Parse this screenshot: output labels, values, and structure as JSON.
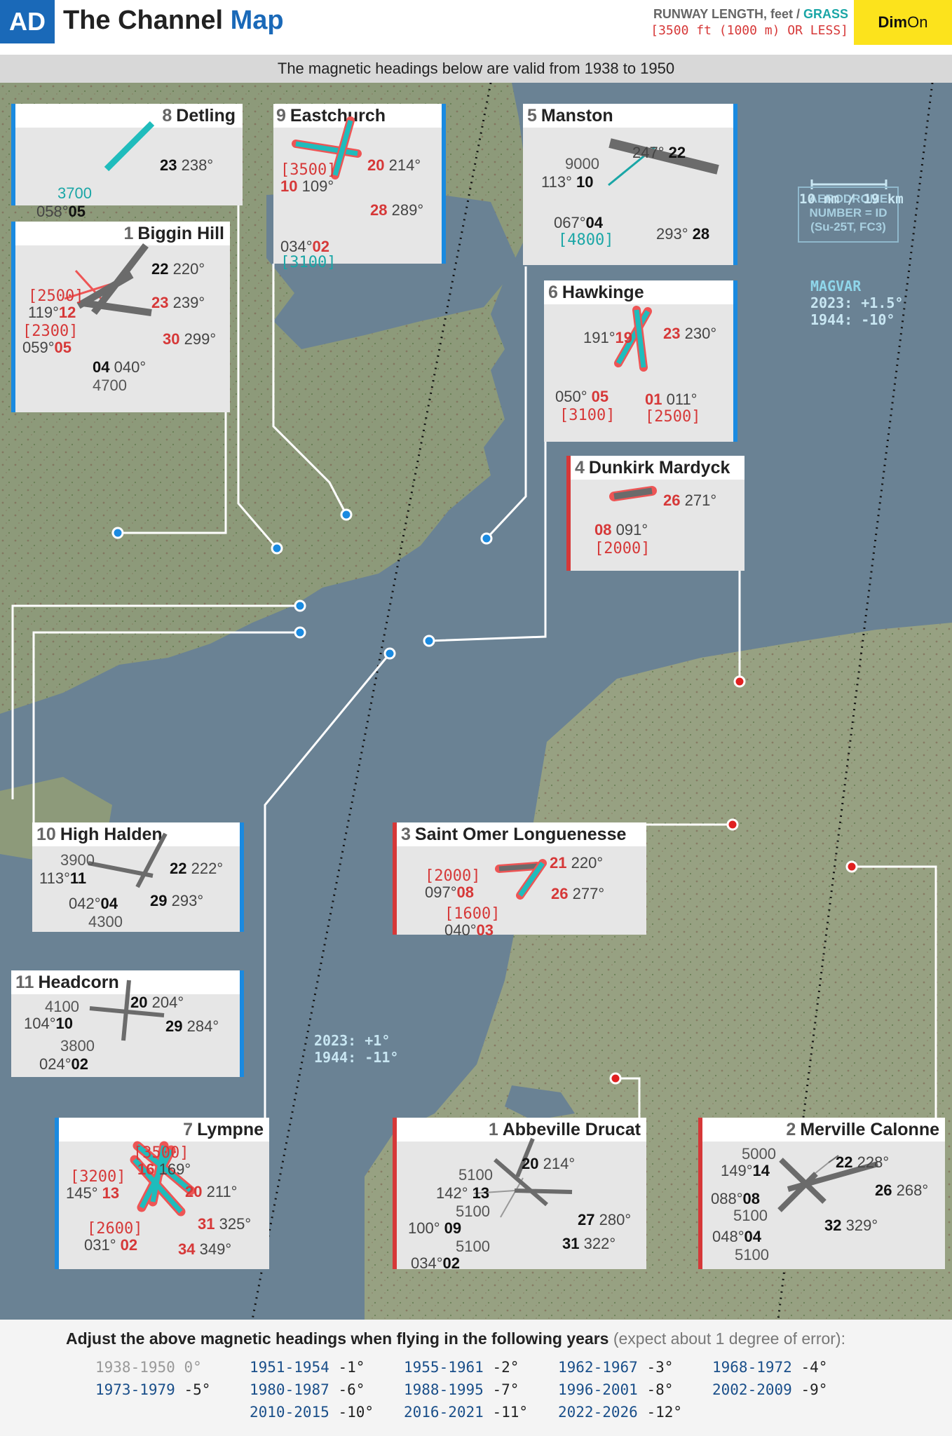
{
  "header": {
    "badge": "AD",
    "title_main": "The Channel",
    "title_accent": "Map",
    "legend_line1": "RUNWAY LENGTH, feet /",
    "legend_grass": "GRASS",
    "legend_line2": "[3500 ft (1000 m) OR LESS]",
    "brand_bold": "Dim",
    "brand_thin": "On"
  },
  "validity": "The magnetic headings below are valid from 1938 to 1950",
  "map": {
    "key_line1": "AERODROME",
    "key_line2": "NUMBER = ID",
    "key_line3": "(Su-25T, FC3)",
    "scale": "10 nm / 19 km",
    "magvar_title": "MAGVAR",
    "magvar_east_1": "2023: +1.5°",
    "magvar_east_2": "1944: -10°",
    "magvar_west_1": "2023: +1°",
    "magvar_west_2": "1944: -11°",
    "colors": {
      "sea": "#6a8294",
      "land": "#8a9a78",
      "blue_pin": "#1a8ae0",
      "red_pin": "#e02020",
      "grass": "#1aa6a6",
      "red_text": "#d63838"
    }
  },
  "airfields": {
    "detling": {
      "num": "8",
      "name": "Detling",
      "h1rw": "23",
      "h1": "238°",
      "len": "3700",
      "h2": "058°",
      "h2rw": "05"
    },
    "eastchurch": {
      "num": "9",
      "name": "Eastchurch",
      "l1": "[3500]",
      "l2rw": "10",
      "l2": "109°",
      "r1rw": "20",
      "r1": "214°",
      "r2rw": "28",
      "r2": "289°",
      "b1": "034°",
      "b1rw": "02",
      "b2": "[3100]"
    },
    "manston": {
      "num": "5",
      "name": "Manston",
      "len": "9000",
      "l1": "113°",
      "l1rw": "10",
      "t1": "247°",
      "t1rw": "22",
      "b1": "067°",
      "b1rw": "04",
      "b2": "[4800]",
      "r1": "293°",
      "r1rw": "28"
    },
    "biggin": {
      "num": "1",
      "name": "Biggin Hill",
      "r1rw": "22",
      "r1": "220°",
      "l1": "[2500]",
      "l2": "119°",
      "l2rw": "12",
      "r2rw": "23",
      "r2": "239°",
      "l3": "[2300]",
      "l4": "059°",
      "l4rw": "05",
      "r3rw": "30",
      "r3": "299°",
      "b1rw": "04",
      "b1": "040°",
      "b2": "4700"
    },
    "hawkinge": {
      "num": "6",
      "name": "Hawkinge",
      "l1": "191°",
      "l1rw": "19",
      "r1rw": "23",
      "r1": "230°",
      "l2": "050°",
      "l2rw": "05",
      "l3": "[3100]",
      "r2rw": "01",
      "r2": "011°",
      "r3": "[2500]"
    },
    "dunkirk": {
      "num": "4",
      "name": "Dunkirk Mardyck",
      "r1rw": "26",
      "r1": "271°",
      "l1rw": "08",
      "l1": "091°",
      "b1": "[2000]"
    },
    "highhalden": {
      "num": "10",
      "name": "High Halden",
      "len1": "3900",
      "l1": "113°",
      "l1rw": "11",
      "r1rw": "22",
      "r1": "222°",
      "r2rw": "29",
      "r2": "293°",
      "b1": "042°",
      "b1rw": "04",
      "b2": "4300"
    },
    "headcorn": {
      "num": "11",
      "name": "Headcorn",
      "len1": "4100",
      "l1": "104°",
      "l1rw": "10",
      "r1rw": "20",
      "r1": "204°",
      "r2rw": "29",
      "r2": "284°",
      "len2": "3800",
      "b1": "024°",
      "b1rw": "02"
    },
    "stomer": {
      "num": "3",
      "name": "Saint Omer Longuenesse",
      "r1rw": "21",
      "r1": "220°",
      "l1": "[2000]",
      "l2": "097°",
      "l2rw": "08",
      "r2rw": "26",
      "r2": "277°",
      "l3": "[1600]",
      "l4": "040°",
      "l4rw": "03"
    },
    "lympne": {
      "num": "7",
      "name": "Lympne",
      "t1": "[3500]",
      "t2rw": "16",
      "t2": "169°",
      "l1": "[3200]",
      "l2": "145°",
      "l2rw": "13",
      "r1rw": "20",
      "r1": "211°",
      "r2rw": "31",
      "r2": "325°",
      "l3": "[2600]",
      "l4": "031°",
      "l4rw": "02",
      "r3rw": "34",
      "r3": "349°"
    },
    "abbeville": {
      "num": "1",
      "name": "Abbeville Drucat",
      "len1": "5100",
      "l1": "142°",
      "l1rw": "13",
      "t1rw": "20",
      "t1": "214°",
      "len2": "5100",
      "l2": "100°",
      "l2rw": "09",
      "r1rw": "27",
      "r1": "280°",
      "len3": "5100",
      "l3": "034°",
      "l3rw": "02",
      "r2rw": "31",
      "r2": "322°"
    },
    "merville": {
      "num": "2",
      "name": "Merville Calonne",
      "len1": "5000",
      "l1": "149°",
      "l1rw": "14",
      "r1rw": "22",
      "r1": "228°",
      "l2": "088°",
      "l2rw": "08",
      "r2rw": "26",
      "r2": "268°",
      "len2": "5100",
      "r3rw": "32",
      "r3": "329°",
      "l3": "048°",
      "l3rw": "04",
      "len3": "5100"
    }
  },
  "footer": {
    "title": "Adjust the above magnetic headings when flying in the following years",
    "note": "(expect about 1 degree of error):",
    "adjust": [
      {
        "years": "1938-1950",
        "delta": "0°"
      },
      {
        "years": "1951-1954",
        "delta": "-1°"
      },
      {
        "years": "1955-1961",
        "delta": "-2°"
      },
      {
        "years": "1962-1967",
        "delta": "-3°"
      },
      {
        "years": "1968-1972",
        "delta": "-4°"
      },
      {
        "years": "1973-1979",
        "delta": "-5°"
      },
      {
        "years": "1980-1987",
        "delta": "-6°"
      },
      {
        "years": "1988-1995",
        "delta": "-7°"
      },
      {
        "years": "1996-2001",
        "delta": "-8°"
      },
      {
        "years": "2002-2009",
        "delta": "-9°"
      },
      {
        "years": "2010-2015",
        "delta": "-10°"
      },
      {
        "years": "2016-2021",
        "delta": "-11°"
      },
      {
        "years": "2022-2026",
        "delta": "-12°"
      }
    ]
  }
}
